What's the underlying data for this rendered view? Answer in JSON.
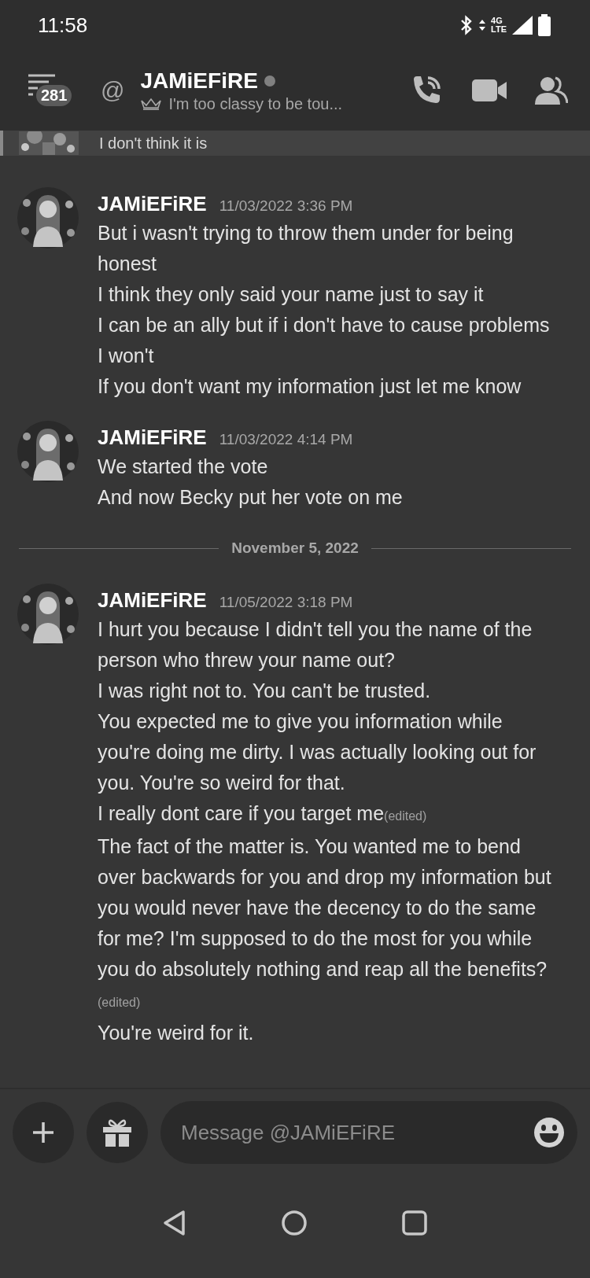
{
  "status_bar": {
    "time": "11:58",
    "network": "4G",
    "network_sub": "LTE"
  },
  "header": {
    "badge": "281",
    "at": "@",
    "name": "JAMiEFiRE",
    "status": "I'm too classy to be tou..."
  },
  "previous_message": {
    "text": "I don't think it is"
  },
  "messages": [
    {
      "kind": "group",
      "author": "JAMiEFiRE",
      "time": "11/03/2022 3:36 PM",
      "lines": [
        {
          "text": "But i wasn't trying to throw them under for being honest"
        },
        {
          "text": "I think they only said your name just to say it"
        },
        {
          "text": "I can be an ally but if i don't have to cause problems I won't"
        },
        {
          "text": "If you don't want my information just let me know"
        }
      ]
    },
    {
      "kind": "group",
      "author": "JAMiEFiRE",
      "time": "11/03/2022 4:14 PM",
      "lines": [
        {
          "text": "We started the vote"
        },
        {
          "text": "And now Becky put her vote on me"
        }
      ]
    },
    {
      "kind": "divider",
      "label": "November 5, 2022"
    },
    {
      "kind": "group",
      "author": "JAMiEFiRE",
      "time": "11/05/2022 3:18 PM",
      "lines": [
        {
          "text": "I hurt you because I didn't tell you the name of the person who threw your name out?"
        },
        {
          "text": "I was right not to. You can't be trusted."
        },
        {
          "text": "You expected me to give you information while you're doing me dirty. I was actually looking out for you. You're so weird for that."
        },
        {
          "text": "I really dont care if you target me",
          "edited_tag": "(edited)"
        },
        {
          "text": "The fact of the matter is. You wanted me to bend over backwards for you and drop my information but you would never have the decency to do the same for me? I'm supposed to do the most for you while you do absolutely nothing and reap all the benefits?",
          "edited_tag": "(edited)"
        },
        {
          "text": "You're weird for it."
        }
      ]
    }
  ],
  "composer": {
    "placeholder": "Message @JAMiEFiRE"
  }
}
